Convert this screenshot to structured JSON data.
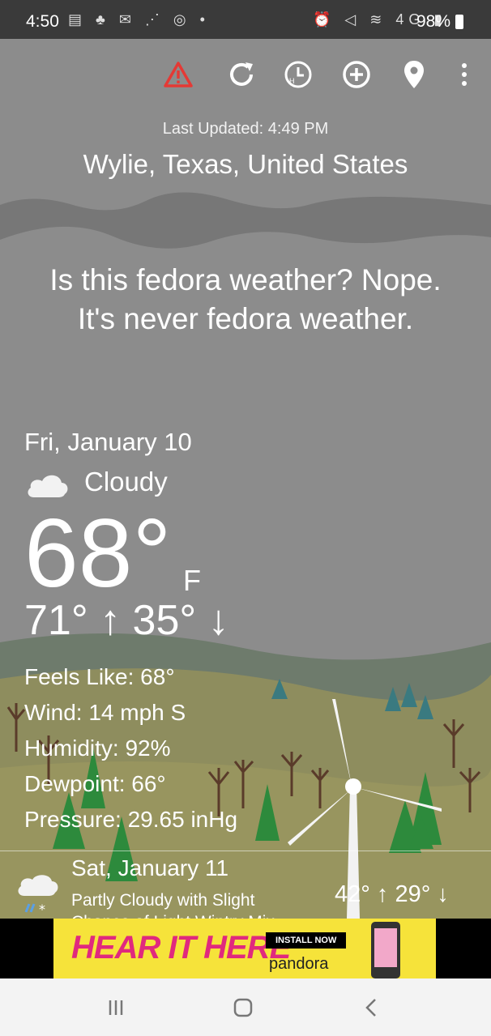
{
  "status_bar": {
    "time": "4:50",
    "left_icons": "▤ ♣ ✉ ⋰ ◎ •",
    "right_icons": "⏰ ◁ ≋ 4G ▮",
    "battery": "98%"
  },
  "toolbar": {
    "alert_icon": "warning-icon",
    "refresh_icon": "refresh-icon",
    "hourly_icon": "clock-icon",
    "add_icon": "add-location-icon",
    "location_icon": "map-pin-icon",
    "menu_icon": "overflow-menu-icon",
    "alert_color": "#e53935"
  },
  "header": {
    "last_updated": "Last Updated: 4:49 PM",
    "location": "Wylie, Texas, United States"
  },
  "quote": "Is this fedora weather? Nope. It's never fedora weather.",
  "current": {
    "date": "Fri, January 10",
    "condition": "Cloudy",
    "temperature": "68°",
    "unit": "F",
    "hi_lo": "71° ↑ 35° ↓",
    "feels_like": "Feels Like: 68°",
    "wind": "Wind: 14 mph S",
    "humidity": "Humidity: 92%",
    "dewpoint": "Dewpoint: 66°",
    "pressure": "Pressure: 29.65 inHg"
  },
  "forecast": {
    "date": "Sat, January 11",
    "description": "Partly Cloudy with Slight Chance of Light Wintry Mix",
    "hi_lo": "42° ↑  29° ↓"
  },
  "ad": {
    "headline": "HEAR IT HERE",
    "install": "INSTALL NOW",
    "brand": "pandora"
  },
  "nav": {
    "recents_icon": "recents-icon",
    "home_icon": "home-icon",
    "back_icon": "back-icon"
  }
}
